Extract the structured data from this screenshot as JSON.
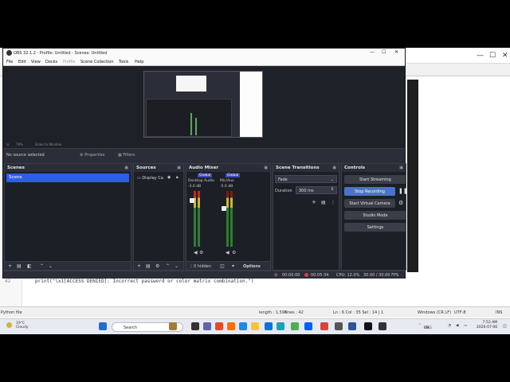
{
  "obs": {
    "title": "OBS 32.1.2 - Profile: Untitled - Scenes: Untitled",
    "menu": [
      "File",
      "Edit",
      "View",
      "Docks",
      "Profile",
      "Scene Collection",
      "Tools",
      "Help"
    ],
    "zoom": "79%",
    "scale_mode": "Scale to Window",
    "no_source": "No source selected",
    "properties_label": "Properties",
    "filters_label": "Filters",
    "scenes": {
      "title": "Scenes",
      "items": [
        "Scene"
      ]
    },
    "sources": {
      "title": "Sources",
      "items": [
        "Display Ca"
      ]
    },
    "mixer": {
      "title": "Audio Mixer",
      "ch1": {
        "tag": "Global",
        "name": "Desktop Audio",
        "db": "-3.0 dB",
        "level": 0.45
      },
      "ch2": {
        "tag": "Global",
        "name": "Mic/Aux",
        "db": "-5.0 dB",
        "level": 0.3
      },
      "hidden": "0 hidden",
      "options": "Options"
    },
    "transitions": {
      "title": "Scene Transitions",
      "type": "Fade",
      "duration_label": "Duration",
      "duration": "300 ms"
    },
    "controls": {
      "title": "Controls",
      "start_streaming": "Start Streaming",
      "stop_recording": "Stop Recording",
      "start_virtual_camera": "Start Virtual Camera",
      "studio_mode": "Studio Mode",
      "settings": "Settings"
    },
    "status": {
      "stream_time": "00:00:00",
      "rec_time": "00:05:34",
      "cpu": "CPU: 12.0%",
      "fps": "30.00 / 30.00 FPS"
    }
  },
  "editor": {
    "line_number": "42",
    "code": "print(\"\\x1[ACCESS DENIED]: Incorrect password or color matrix combination.\")",
    "file_type": "Python file",
    "status": {
      "length": "length : 1,596",
      "lines": "lines : 42",
      "position": "Ln : 6    Col : 35    Sel : 14 | 1",
      "eol": "Windows (CR LF)",
      "encoding": "UTF-8",
      "mode": "INS"
    }
  },
  "taskbar": {
    "weather_temp": "19°C",
    "weather_desc": "Cloudy",
    "search": "Search",
    "lang": "ENG",
    "region": "US",
    "time": "7:53 AM",
    "date": "2026-07-06"
  }
}
